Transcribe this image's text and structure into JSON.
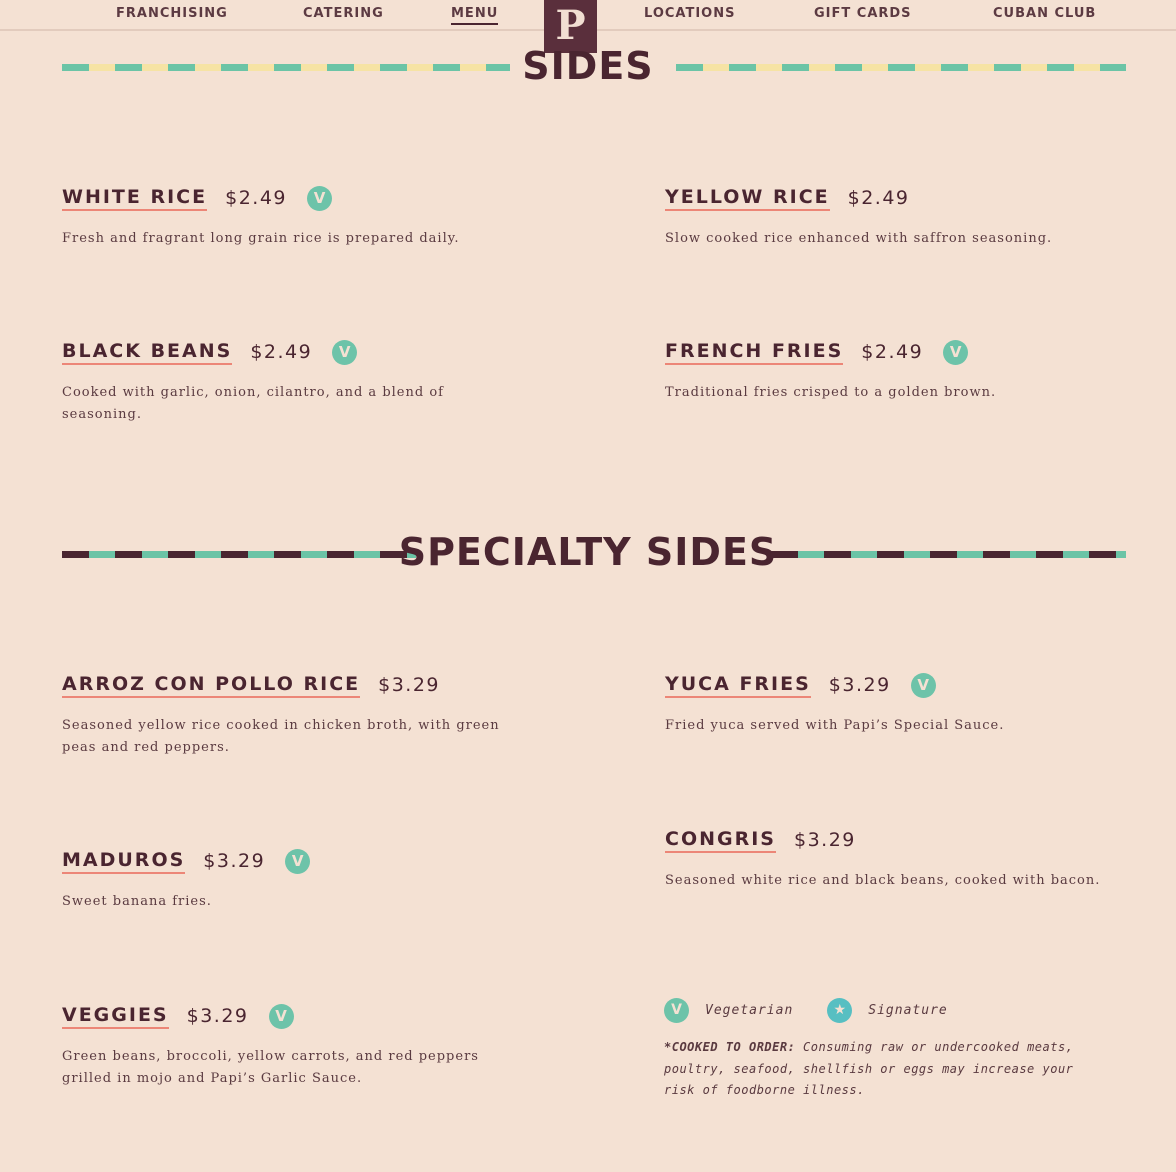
{
  "nav": {
    "items": [
      "FRANCHISING",
      "CATERING",
      "MENU",
      "LOCATIONS",
      "GIFT CARDS",
      "CUBAN CLUB"
    ],
    "active": "MENU",
    "logo_letter": "P"
  },
  "sections": {
    "sides": {
      "title": "SIDES",
      "items": [
        {
          "name": "WHITE RICE",
          "price": "$2.49",
          "vegetarian": true,
          "desc": "Fresh and fragrant long grain rice is prepared daily."
        },
        {
          "name": "YELLOW RICE",
          "price": "$2.49",
          "vegetarian": false,
          "desc": "Slow cooked rice enhanced with saffron seasoning."
        },
        {
          "name": "BLACK BEANS",
          "price": "$2.49",
          "vegetarian": true,
          "desc": "Cooked with garlic, onion, cilantro, and a blend of seasoning."
        },
        {
          "name": "FRENCH FRIES",
          "price": "$2.49",
          "vegetarian": true,
          "desc": "Traditional fries crisped to a golden brown."
        }
      ]
    },
    "specialty": {
      "title": "SPECIALTY SIDES",
      "items": [
        {
          "name": "ARROZ CON POLLO RICE",
          "price": "$3.29",
          "vegetarian": false,
          "desc": "Seasoned yellow rice cooked in chicken broth, with green peas and red peppers."
        },
        {
          "name": "YUCA FRIES",
          "price": "$3.29",
          "vegetarian": true,
          "desc": "Fried yuca served with Papi’s Special Sauce."
        },
        {
          "name": "MADUROS",
          "price": "$3.29",
          "vegetarian": true,
          "desc": "Sweet banana fries."
        },
        {
          "name": "CONGRIS",
          "price": "$3.29",
          "vegetarian": false,
          "desc": "Seasoned white rice and black beans, cooked with bacon."
        },
        {
          "name": "VEGGIES",
          "price": "$3.29",
          "vegetarian": true,
          "desc": "Green beans, broccoli, yellow carrots, and red peppers grilled in mojo and Papi’s Garlic Sauce."
        }
      ]
    }
  },
  "badge_letter": "V",
  "legend": {
    "vegetarian_badge": "V",
    "vegetarian_label": "Vegetarian",
    "signature_badge": "★",
    "signature_label": "Signature",
    "disclaimer_bold": "*COOKED TO ORDER:",
    "disclaimer_text": " Consuming raw or undercooked meats, poultry, seafood, shellfish or eggs may increase your risk of foodborne illness."
  },
  "colors": {
    "background": "#f4e1d3",
    "text": "#4a2530",
    "accent_teal": "#6bc4a6",
    "accent_yellow": "#f6e3a4",
    "underline": "#ec8677",
    "logo_bg": "#5a2f3c"
  }
}
